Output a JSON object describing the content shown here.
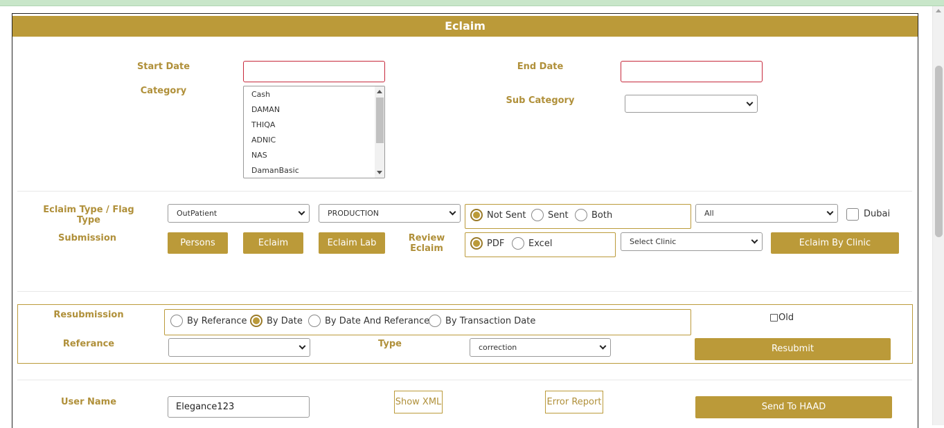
{
  "page": {
    "title": "Eclaim"
  },
  "dates": {
    "start_label": "Start Date",
    "start_value": "",
    "end_label": "End Date",
    "end_value": ""
  },
  "category": {
    "label": "Category",
    "options": [
      "Cash",
      "DAMAN",
      "THIQA",
      "ADNIC",
      "NAS",
      "DamanBasic"
    ]
  },
  "sub_category": {
    "label": "Sub Category",
    "selected": ""
  },
  "eclaim_type": {
    "label": "Eclaim Type / Flag Type",
    "type_selected": "OutPatient",
    "flag_selected": "PRODUCTION",
    "status_options": [
      "Not Sent",
      "Sent",
      "Both"
    ],
    "status_selected": "Not Sent",
    "filter_selected": "All",
    "dubai_label": "Dubai",
    "dubai_checked": false
  },
  "submission": {
    "label": "Submission",
    "buttons": [
      "Persons",
      "Eclaim",
      "Eclaim Lab"
    ],
    "review_label": "Review Eclaim",
    "format_options": [
      "PDF",
      "Excel"
    ],
    "format_selected": "PDF",
    "clinic_selected": "Select Clinic",
    "clinic_button": "Eclaim By Clinic"
  },
  "resubmission": {
    "label": "Resubmission",
    "mode_options": [
      "By Referance",
      "By Date",
      "By Date And Referance",
      "By Transaction Date"
    ],
    "mode_selected": "By Date",
    "old_label": "Old",
    "reference_label": "Referance",
    "reference_selected": "",
    "type_label": "Type",
    "type_selected": "correction",
    "resubmit_button": "Resubmit"
  },
  "haad": {
    "user_label": "User Name",
    "user_value": "Elegance123",
    "show_xml": "Show XML",
    "error_report": "Error Report",
    "send_button": "Send To HAAD"
  },
  "colors": {
    "accent": "#bb9a39",
    "label": "#b0903a",
    "error_border": "#c6273a",
    "top_bar": "#c8e6c9"
  }
}
